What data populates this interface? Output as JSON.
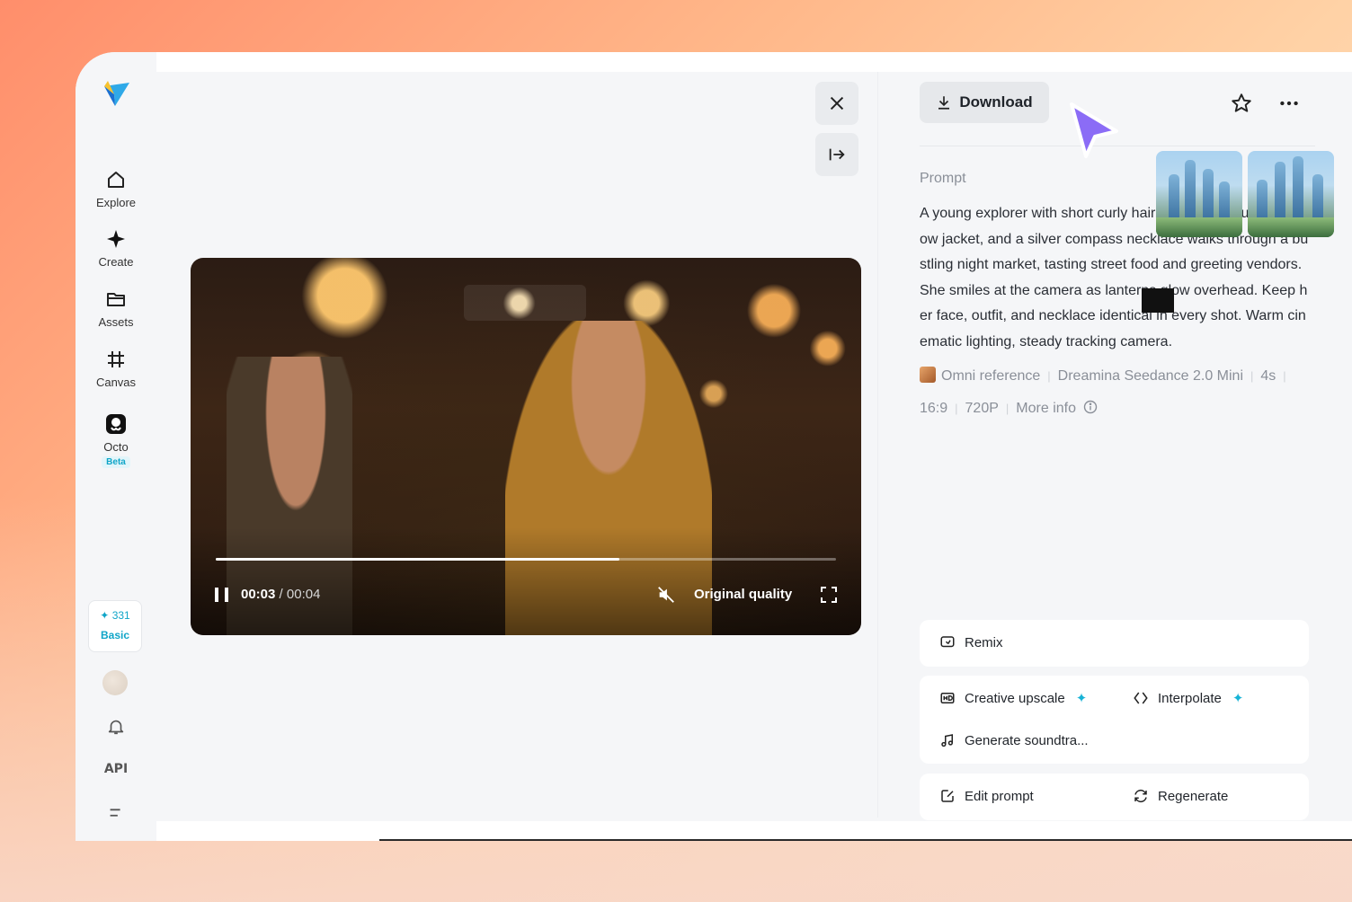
{
  "sidebar": {
    "items": [
      {
        "label": "Explore",
        "icon": "home-icon"
      },
      {
        "label": "Create",
        "icon": "sparkle-icon"
      },
      {
        "label": "Assets",
        "icon": "folder-icon"
      },
      {
        "label": "Canvas",
        "icon": "canvas-grid-icon"
      },
      {
        "label": "Octo",
        "icon": "octo-icon",
        "badge": "Beta"
      }
    ],
    "credits": {
      "amount": "331",
      "plan": "Basic"
    },
    "api_label": "API"
  },
  "viewer": {
    "close_icon": "close-icon",
    "collapse_icon": "collapse-panel-icon"
  },
  "video": {
    "current_time": "00:03",
    "duration": "/ 00:04",
    "quality": "Original quality",
    "progress": 0.65
  },
  "panel": {
    "download_label": "Download",
    "prompt_label": "Prompt",
    "prompt_text": "A young explorer with short curly hair, wearing a mustard yellow jacket, and a silver compass necklace walks through a bustling night market, tasting street food and greeting vendors. She smiles at the camera as lanterns glow overhead. Keep her face, outfit, and necklace identical in every shot. Warm cinematic lighting, steady tracking camera.",
    "meta": {
      "reference": "Omni reference",
      "model": "Dreamina Seedance 2.0 Mini",
      "duration": "4s",
      "ratio": "16:9",
      "resolution": "720P",
      "more_info": "More info"
    }
  },
  "actions": {
    "remix": "Remix",
    "creative_upscale": "Creative upscale",
    "interpolate": "Interpolate",
    "generate_soundtrack": "Generate soundtra...",
    "edit_prompt": "Edit prompt",
    "regenerate": "Regenerate"
  },
  "colors": {
    "accent": "#17b3d6",
    "cursor": "#8b6cf6"
  }
}
